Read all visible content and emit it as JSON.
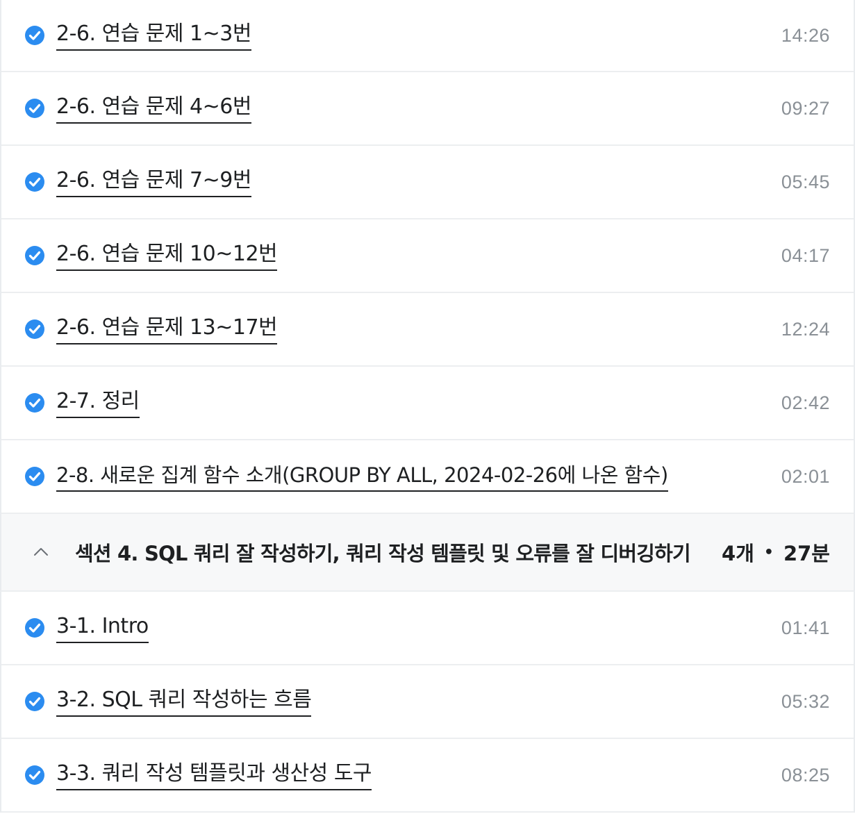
{
  "colors": {
    "check": "#2b8cf0",
    "title": "#1e2022",
    "duration": "#8a9096",
    "section_bg": "#f7f8f9"
  },
  "lessons_before": [
    {
      "title": "2-6. 연습 문제 1~3번",
      "duration": "14:26",
      "icon": "check-circle-icon"
    },
    {
      "title": "2-6. 연습 문제 4~6번",
      "duration": "09:27",
      "icon": "check-circle-icon"
    },
    {
      "title": "2-6. 연습 문제 7~9번",
      "duration": "05:45",
      "icon": "check-circle-icon"
    },
    {
      "title": "2-6. 연습 문제 10~12번",
      "duration": "04:17",
      "icon": "check-circle-icon"
    },
    {
      "title": "2-6. 연습 문제 13~17번",
      "duration": "12:24",
      "icon": "check-circle-icon"
    },
    {
      "title": "2-7. 정리",
      "duration": "02:42",
      "icon": "check-circle-icon"
    },
    {
      "title": "2-8. 새로운 집계 함수 소개(GROUP BY ALL, 2024-02-26에 나온 함수)",
      "duration": "02:01",
      "icon": "check-circle-icon"
    }
  ],
  "section": {
    "icon": "chevron-up-icon",
    "title": "섹션 4. SQL 쿼리 잘 작성하기, 쿼리 작성 템플릿 및 오류를 잘 디버깅하기",
    "count": "4개",
    "separator": "•",
    "total_time": "27분"
  },
  "lessons_after": [
    {
      "title": "3-1. Intro",
      "duration": "01:41",
      "icon": "check-circle-icon"
    },
    {
      "title": "3-2. SQL 쿼리 작성하는 흐름",
      "duration": "05:32",
      "icon": "check-circle-icon"
    },
    {
      "title": "3-3. 쿼리 작성 템플릿과 생산성 도구",
      "duration": "08:25",
      "icon": "check-circle-icon"
    }
  ]
}
